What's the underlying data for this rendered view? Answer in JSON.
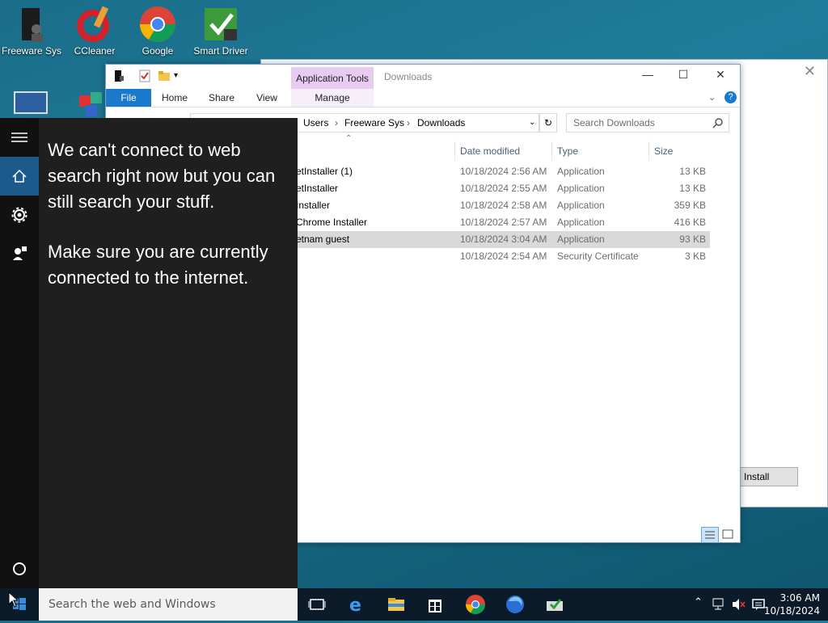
{
  "desktop": {
    "icons": [
      {
        "label": "Freeware Sys"
      },
      {
        "label": "CCleaner"
      },
      {
        "label": "Google\nChrome"
      },
      {
        "label": "Smart Driver\nUpdater"
      }
    ]
  },
  "background_window": {
    "install_label": "Install"
  },
  "explorer": {
    "title": "Downloads",
    "context_tab": "Application Tools",
    "ribbon_tabs": {
      "file": "File",
      "home": "Home",
      "share": "Share",
      "view": "View",
      "manage": "Manage"
    },
    "breadcrumb": [
      "Users",
      "Freeware Sys",
      "Downloads"
    ],
    "search_placeholder": "Search Downloads",
    "columns": {
      "date": "Date modified",
      "type": "Type",
      "size": "Size"
    },
    "files": [
      {
        "name": "etInstaller (1)",
        "date": "10/18/2024 2:56 AM",
        "type": "Application",
        "size": "13 KB"
      },
      {
        "name": "etInstaller",
        "date": "10/18/2024 2:55 AM",
        "type": "Application",
        "size": "13 KB"
      },
      {
        "name": "Installer",
        "date": "10/18/2024 2:58 AM",
        "type": "Application",
        "size": "359 KB"
      },
      {
        "name": "Chrome Installer",
        "date": "10/18/2024 2:57 AM",
        "type": "Application",
        "size": "416 KB"
      },
      {
        "name": "etnam guest",
        "date": "10/18/2024 3:04 AM",
        "type": "Application",
        "size": "93 KB"
      },
      {
        "name": "",
        "date": "10/18/2024 2:54 AM",
        "type": "Security Certificate",
        "size": "3 KB"
      }
    ]
  },
  "start_panel": {
    "message1": "We can't connect to web search right now but you can still search your stuff.",
    "message2": "Make sure you are currently connected to the internet."
  },
  "taskbar": {
    "search_placeholder": "Search the web and Windows",
    "time": "3:06 AM",
    "date": "10/18/2024"
  },
  "colors": {
    "accent": "#1979ca",
    "selected_row": "#d9d9d9",
    "context_tab": "#e7cbf0"
  }
}
